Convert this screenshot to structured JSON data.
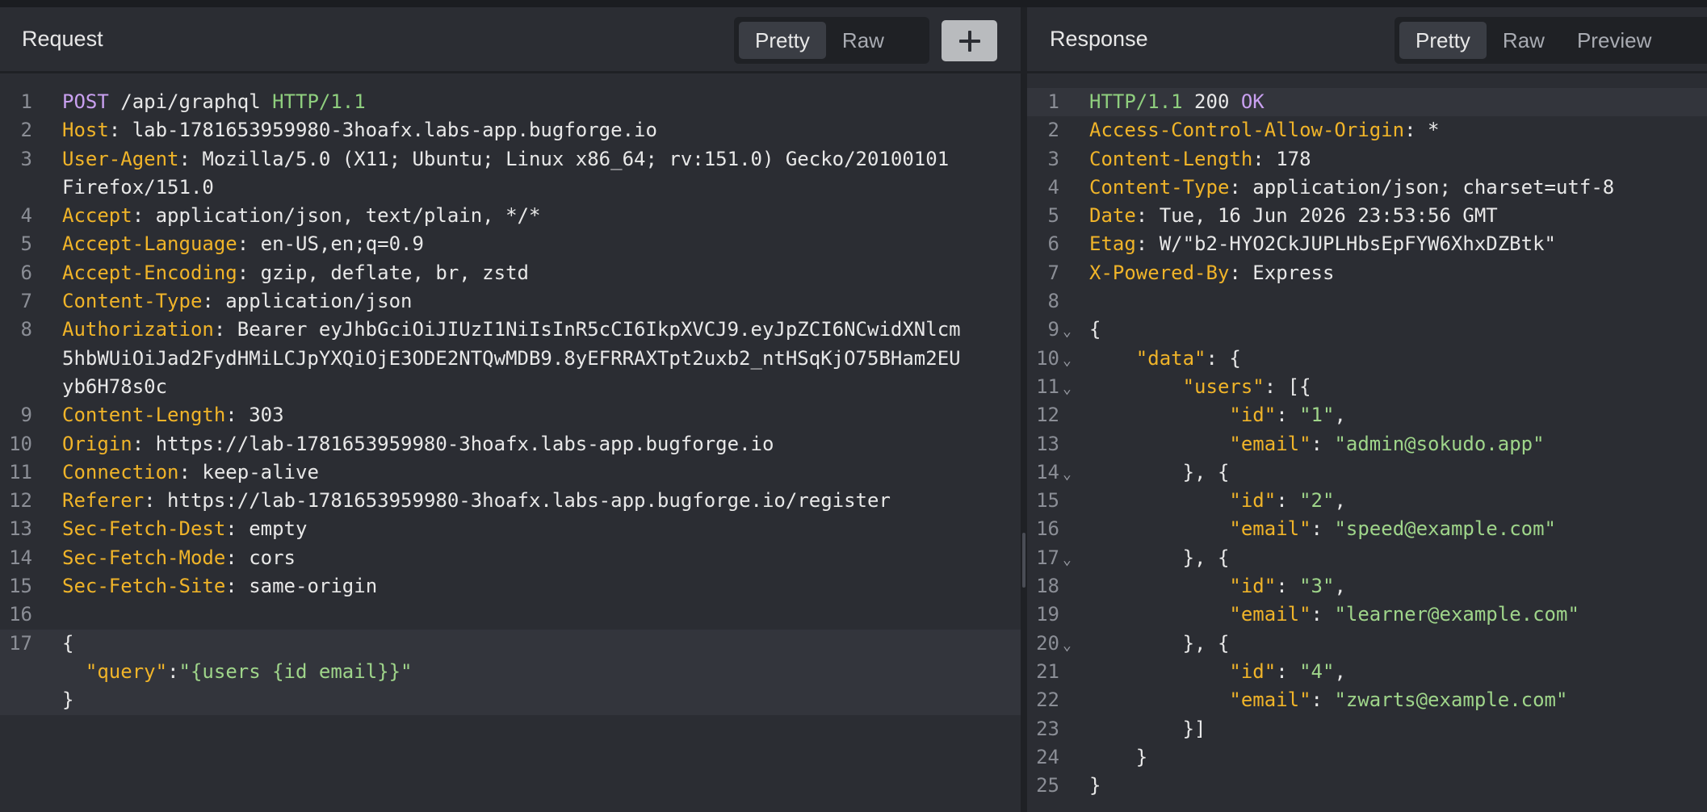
{
  "request": {
    "title": "Request",
    "tabs": [
      {
        "label": "Pretty",
        "active": true
      },
      {
        "label": "Raw",
        "active": false
      }
    ],
    "add_icon": "plus-icon",
    "lines": [
      {
        "n": "1",
        "parts": [
          {
            "c": "meth",
            "t": "POST"
          },
          {
            "c": "punc",
            "t": " /api/graphql "
          },
          {
            "c": "proto",
            "t": "HTTP/1.1"
          }
        ]
      },
      {
        "n": "2",
        "parts": [
          {
            "c": "hk",
            "t": "Host"
          },
          {
            "c": "punc",
            "t": ": lab-1781653959980-3hoafx.labs-app.bugforge.io"
          }
        ]
      },
      {
        "n": "3",
        "parts": [
          {
            "c": "hk",
            "t": "User-Agent"
          },
          {
            "c": "punc",
            "t": ": Mozilla/5.0 (X11; Ubuntu; Linux x86_64; rv:151.0) Gecko/20100101"
          }
        ]
      },
      {
        "n": "",
        "parts": [
          {
            "c": "punc",
            "t": "Firefox/151.0"
          }
        ]
      },
      {
        "n": "4",
        "parts": [
          {
            "c": "hk",
            "t": "Accept"
          },
          {
            "c": "punc",
            "t": ": application/json, text/plain, */*"
          }
        ]
      },
      {
        "n": "5",
        "parts": [
          {
            "c": "hk",
            "t": "Accept-Language"
          },
          {
            "c": "punc",
            "t": ": en-US,en;q=0.9"
          }
        ]
      },
      {
        "n": "6",
        "parts": [
          {
            "c": "hk",
            "t": "Accept-Encoding"
          },
          {
            "c": "punc",
            "t": ": gzip, deflate, br, zstd"
          }
        ]
      },
      {
        "n": "7",
        "parts": [
          {
            "c": "hk",
            "t": "Content-Type"
          },
          {
            "c": "punc",
            "t": ": application/json"
          }
        ]
      },
      {
        "n": "8",
        "parts": [
          {
            "c": "hk",
            "t": "Authorization"
          },
          {
            "c": "punc",
            "t": ": Bearer eyJhbGciOiJIUzI1NiIsInR5cCI6IkpXVCJ9.eyJpZCI6NCwidXNlcm"
          }
        ]
      },
      {
        "n": "",
        "parts": [
          {
            "c": "punc",
            "t": "5hbWUiOiJad2FydHMiLCJpYXQiOjE3ODE2NTQwMDB9.8yEFRRAXTpt2uxb2_ntHSqKjO75BHam2EU"
          }
        ]
      },
      {
        "n": "",
        "parts": [
          {
            "c": "punc",
            "t": "yb6H78s0c"
          }
        ]
      },
      {
        "n": "9",
        "parts": [
          {
            "c": "hk",
            "t": "Content-Length"
          },
          {
            "c": "punc",
            "t": ": 303"
          }
        ]
      },
      {
        "n": "10",
        "parts": [
          {
            "c": "hk",
            "t": "Origin"
          },
          {
            "c": "punc",
            "t": ": https://lab-1781653959980-3hoafx.labs-app.bugforge.io"
          }
        ]
      },
      {
        "n": "11",
        "parts": [
          {
            "c": "hk",
            "t": "Connection"
          },
          {
            "c": "punc",
            "t": ": keep-alive"
          }
        ]
      },
      {
        "n": "12",
        "parts": [
          {
            "c": "hk",
            "t": "Referer"
          },
          {
            "c": "punc",
            "t": ": https://lab-1781653959980-3hoafx.labs-app.bugforge.io/register"
          }
        ]
      },
      {
        "n": "13",
        "parts": [
          {
            "c": "hk",
            "t": "Sec-Fetch-Dest"
          },
          {
            "c": "punc",
            "t": ": empty"
          }
        ]
      },
      {
        "n": "14",
        "parts": [
          {
            "c": "hk",
            "t": "Sec-Fetch-Mode"
          },
          {
            "c": "punc",
            "t": ": cors"
          }
        ]
      },
      {
        "n": "15",
        "parts": [
          {
            "c": "hk",
            "t": "Sec-Fetch-Site"
          },
          {
            "c": "punc",
            "t": ": same-origin"
          }
        ]
      },
      {
        "n": "16",
        "parts": []
      },
      {
        "n": "17",
        "hl": true,
        "parts": [
          {
            "c": "punc",
            "t": "{"
          }
        ]
      },
      {
        "n": "",
        "hl": true,
        "parts": [
          {
            "c": "punc",
            "t": "  "
          },
          {
            "c": "jk",
            "t": "\"query\""
          },
          {
            "c": "punc",
            "t": ":"
          },
          {
            "c": "js",
            "t": "\"{users {id email}}\""
          }
        ]
      },
      {
        "n": "",
        "hl": true,
        "parts": [
          {
            "c": "punc",
            "t": "}"
          }
        ]
      }
    ]
  },
  "response": {
    "title": "Response",
    "tabs": [
      {
        "label": "Pretty",
        "active": true
      },
      {
        "label": "Raw",
        "active": false
      },
      {
        "label": "Preview",
        "active": false
      }
    ],
    "lines": [
      {
        "n": "1",
        "hl": true,
        "parts": [
          {
            "c": "proto",
            "t": "HTTP/1.1"
          },
          {
            "c": "punc",
            "t": " 200 "
          },
          {
            "c": "ok",
            "t": "OK"
          }
        ]
      },
      {
        "n": "2",
        "parts": [
          {
            "c": "hk",
            "t": "Access-Control-Allow-Origin"
          },
          {
            "c": "punc",
            "t": ": *"
          }
        ]
      },
      {
        "n": "3",
        "parts": [
          {
            "c": "hk",
            "t": "Content-Length"
          },
          {
            "c": "punc",
            "t": ": 178"
          }
        ]
      },
      {
        "n": "4",
        "parts": [
          {
            "c": "hk",
            "t": "Content-Type"
          },
          {
            "c": "punc",
            "t": ": application/json; charset=utf-8"
          }
        ]
      },
      {
        "n": "5",
        "parts": [
          {
            "c": "hk",
            "t": "Date"
          },
          {
            "c": "punc",
            "t": ": Tue, 16 Jun 2026 23:53:56 GMT"
          }
        ]
      },
      {
        "n": "6",
        "parts": [
          {
            "c": "hk",
            "t": "Etag"
          },
          {
            "c": "punc",
            "t": ": W/\"b2-HYO2CkJUPLHbsEpFYW6XhxDZBtk\""
          }
        ]
      },
      {
        "n": "7",
        "parts": [
          {
            "c": "hk",
            "t": "X-Powered-By"
          },
          {
            "c": "punc",
            "t": ": Express"
          }
        ]
      },
      {
        "n": "8",
        "parts": []
      },
      {
        "n": "9",
        "fold": true,
        "parts": [
          {
            "c": "punc",
            "t": "{"
          }
        ]
      },
      {
        "n": "10",
        "fold": true,
        "parts": [
          {
            "c": "punc",
            "t": "    "
          },
          {
            "c": "jk",
            "t": "\"data\""
          },
          {
            "c": "punc",
            "t": ": {"
          }
        ]
      },
      {
        "n": "11",
        "fold": true,
        "parts": [
          {
            "c": "punc",
            "t": "        "
          },
          {
            "c": "jk",
            "t": "\"users\""
          },
          {
            "c": "punc",
            "t": ": [{"
          }
        ]
      },
      {
        "n": "12",
        "parts": [
          {
            "c": "punc",
            "t": "            "
          },
          {
            "c": "jk",
            "t": "\"id\""
          },
          {
            "c": "punc",
            "t": ": "
          },
          {
            "c": "js",
            "t": "\"1\""
          },
          {
            "c": "punc",
            "t": ","
          }
        ]
      },
      {
        "n": "13",
        "parts": [
          {
            "c": "punc",
            "t": "            "
          },
          {
            "c": "jk",
            "t": "\"email\""
          },
          {
            "c": "punc",
            "t": ": "
          },
          {
            "c": "js",
            "t": "\"admin@sokudo.app\""
          }
        ]
      },
      {
        "n": "14",
        "fold": true,
        "parts": [
          {
            "c": "punc",
            "t": "        }, {"
          }
        ]
      },
      {
        "n": "15",
        "parts": [
          {
            "c": "punc",
            "t": "            "
          },
          {
            "c": "jk",
            "t": "\"id\""
          },
          {
            "c": "punc",
            "t": ": "
          },
          {
            "c": "js",
            "t": "\"2\""
          },
          {
            "c": "punc",
            "t": ","
          }
        ]
      },
      {
        "n": "16",
        "parts": [
          {
            "c": "punc",
            "t": "            "
          },
          {
            "c": "jk",
            "t": "\"email\""
          },
          {
            "c": "punc",
            "t": ": "
          },
          {
            "c": "js",
            "t": "\"speed@example.com\""
          }
        ]
      },
      {
        "n": "17",
        "fold": true,
        "parts": [
          {
            "c": "punc",
            "t": "        }, {"
          }
        ]
      },
      {
        "n": "18",
        "parts": [
          {
            "c": "punc",
            "t": "            "
          },
          {
            "c": "jk",
            "t": "\"id\""
          },
          {
            "c": "punc",
            "t": ": "
          },
          {
            "c": "js",
            "t": "\"3\""
          },
          {
            "c": "punc",
            "t": ","
          }
        ]
      },
      {
        "n": "19",
        "parts": [
          {
            "c": "punc",
            "t": "            "
          },
          {
            "c": "jk",
            "t": "\"email\""
          },
          {
            "c": "punc",
            "t": ": "
          },
          {
            "c": "js",
            "t": "\"learner@example.com\""
          }
        ]
      },
      {
        "n": "20",
        "fold": true,
        "parts": [
          {
            "c": "punc",
            "t": "        }, {"
          }
        ]
      },
      {
        "n": "21",
        "parts": [
          {
            "c": "punc",
            "t": "            "
          },
          {
            "c": "jk",
            "t": "\"id\""
          },
          {
            "c": "punc",
            "t": ": "
          },
          {
            "c": "js",
            "t": "\"4\""
          },
          {
            "c": "punc",
            "t": ","
          }
        ]
      },
      {
        "n": "22",
        "parts": [
          {
            "c": "punc",
            "t": "            "
          },
          {
            "c": "jk",
            "t": "\"email\""
          },
          {
            "c": "punc",
            "t": ": "
          },
          {
            "c": "js",
            "t": "\"zwarts@example.com\""
          }
        ]
      },
      {
        "n": "23",
        "parts": [
          {
            "c": "punc",
            "t": "        }]"
          }
        ]
      },
      {
        "n": "24",
        "parts": [
          {
            "c": "punc",
            "t": "    }"
          }
        ]
      },
      {
        "n": "25",
        "parts": [
          {
            "c": "punc",
            "t": "}"
          }
        ]
      }
    ]
  },
  "colors": {
    "method": "#c9a0f0",
    "protocol": "#8fcf7e",
    "header_key": "#f0b429",
    "json_string": "#9fd58a",
    "background": "#2b2d33"
  }
}
